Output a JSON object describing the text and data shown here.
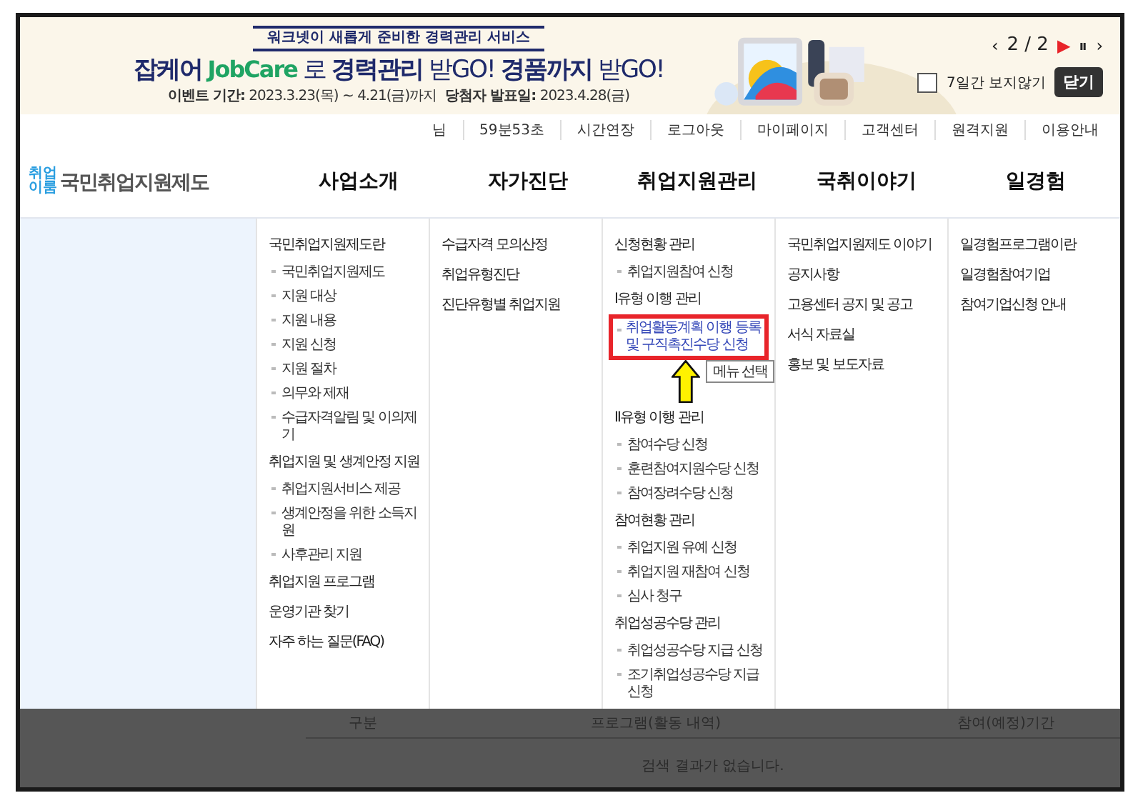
{
  "banner": {
    "kicker": "워크넷이 새롭게 준비한 경력관리 서비스",
    "headline": [
      {
        "kind": "strong",
        "text": "잡케어"
      },
      {
        "kind": "brand",
        "text": "JobCare"
      },
      {
        "kind": "light",
        "text": "로"
      },
      {
        "kind": "strong",
        "text": "경력관리"
      },
      {
        "kind": "light",
        "text": "받GO!"
      },
      {
        "kind": "strong",
        "text": "경품까지"
      },
      {
        "kind": "light",
        "text": "받GO!"
      }
    ],
    "event_label": "이벤트 기간:",
    "event_value": "2023.3.23(목) ~ 4.21(금)까지",
    "winner_label": "당첨자 발표일:",
    "winner_value": "2023.4.28(금)",
    "pager": {
      "prev": "‹",
      "counter": "2 / 2",
      "play": "▶",
      "pause": "⏸",
      "next": "›"
    },
    "hide_week": {
      "label": "7일간 보지않기",
      "checked": false
    },
    "close": "닫기"
  },
  "util_bar": [
    "님",
    "59분53초",
    "시간연장",
    "로그아웃",
    "마이페이지",
    "고객센터",
    "원격지원",
    "이용안내"
  ],
  "logo": {
    "small_top": "취업",
    "small_bottom": "이룸",
    "name": "국민취업지원제도"
  },
  "nav": [
    {
      "label": "사업소개"
    },
    {
      "label": "자가진단"
    },
    {
      "label": "취업지원관리"
    },
    {
      "label": "국취이야기"
    },
    {
      "label": "일경험"
    }
  ],
  "menu_columns": [
    [
      {
        "kind": "head",
        "text": "국민취업지원제도란",
        "selected": false
      },
      {
        "kind": "sub",
        "text": "국민취업지원제도",
        "selected": false
      },
      {
        "kind": "sub",
        "text": "지원 대상",
        "selected": false
      },
      {
        "kind": "sub",
        "text": "지원 내용",
        "selected": false
      },
      {
        "kind": "sub",
        "text": "지원 신청",
        "selected": false
      },
      {
        "kind": "sub",
        "text": "지원 절차",
        "selected": false
      },
      {
        "kind": "sub",
        "text": "의무와 제재",
        "selected": false
      },
      {
        "kind": "sub",
        "text": "수급자격알림 및 이의제기",
        "selected": false
      },
      {
        "kind": "head",
        "text": "취업지원 및 생계안정 지원",
        "selected": false
      },
      {
        "kind": "sub",
        "text": "취업지원서비스 제공",
        "selected": false
      },
      {
        "kind": "sub",
        "text": "생계안정을 위한 소득지원",
        "selected": false
      },
      {
        "kind": "sub",
        "text": "사후관리 지원",
        "selected": false
      },
      {
        "kind": "head",
        "text": "취업지원 프로그램",
        "selected": false
      },
      {
        "kind": "head",
        "text": "운영기관 찾기",
        "selected": false
      },
      {
        "kind": "head",
        "text": "자주 하는 질문(FAQ)",
        "selected": false
      }
    ],
    [
      {
        "kind": "head",
        "text": "수급자격 모의산정",
        "selected": false
      },
      {
        "kind": "head",
        "text": "취업유형진단",
        "selected": false
      },
      {
        "kind": "head",
        "text": "진단유형별 취업지원",
        "selected": false
      }
    ],
    [
      {
        "kind": "head",
        "text": "신청현황 관리",
        "selected": false
      },
      {
        "kind": "sub",
        "text": "취업지원참여 신청",
        "selected": false
      },
      {
        "kind": "head",
        "text": "Ⅰ유형 이행 관리",
        "selected": false
      },
      {
        "kind": "sub",
        "text": "취업활동계획 이행 등록 및 구직촉진수당 신청",
        "selected": true
      },
      {
        "kind": "head",
        "text": "Ⅱ유형 이행 관리",
        "selected": false
      },
      {
        "kind": "sub",
        "text": "참여수당 신청",
        "selected": false
      },
      {
        "kind": "sub",
        "text": "훈련참여지원수당 신청",
        "selected": false
      },
      {
        "kind": "sub",
        "text": "참여장려수당 신청",
        "selected": false
      },
      {
        "kind": "head",
        "text": "참여현황 관리",
        "selected": false
      },
      {
        "kind": "sub",
        "text": "취업지원 유예 신청",
        "selected": false
      },
      {
        "kind": "sub",
        "text": "취업지원 재참여 신청",
        "selected": false
      },
      {
        "kind": "sub",
        "text": "심사 청구",
        "selected": false
      },
      {
        "kind": "head",
        "text": "취업성공수당 관리",
        "selected": false
      },
      {
        "kind": "sub",
        "text": "취업성공수당 지급 신청",
        "selected": false
      },
      {
        "kind": "sub",
        "text": "조기취업성공수당 지급 신청",
        "selected": false
      }
    ],
    [
      {
        "kind": "head",
        "text": "국민취업지원제도 이야기",
        "selected": false
      },
      {
        "kind": "head",
        "text": "공지사항",
        "selected": false
      },
      {
        "kind": "head",
        "text": "고용센터 공지 및 공고",
        "selected": false
      },
      {
        "kind": "head",
        "text": "서식 자료실",
        "selected": false
      },
      {
        "kind": "head",
        "text": "홍보 및 보도자료",
        "selected": false
      }
    ],
    [
      {
        "kind": "head",
        "text": "일경험프로그램이란",
        "selected": false
      },
      {
        "kind": "head",
        "text": "일경험참여기업",
        "selected": false
      },
      {
        "kind": "head",
        "text": "참여기업신청 안내",
        "selected": false
      }
    ]
  ],
  "tooltip": "메뉴 선택",
  "table": {
    "columns": [
      "구분",
      "프로그램(활동 내역)",
      "참여(예정)기간"
    ],
    "empty": "검색 결과가 없습니다."
  }
}
